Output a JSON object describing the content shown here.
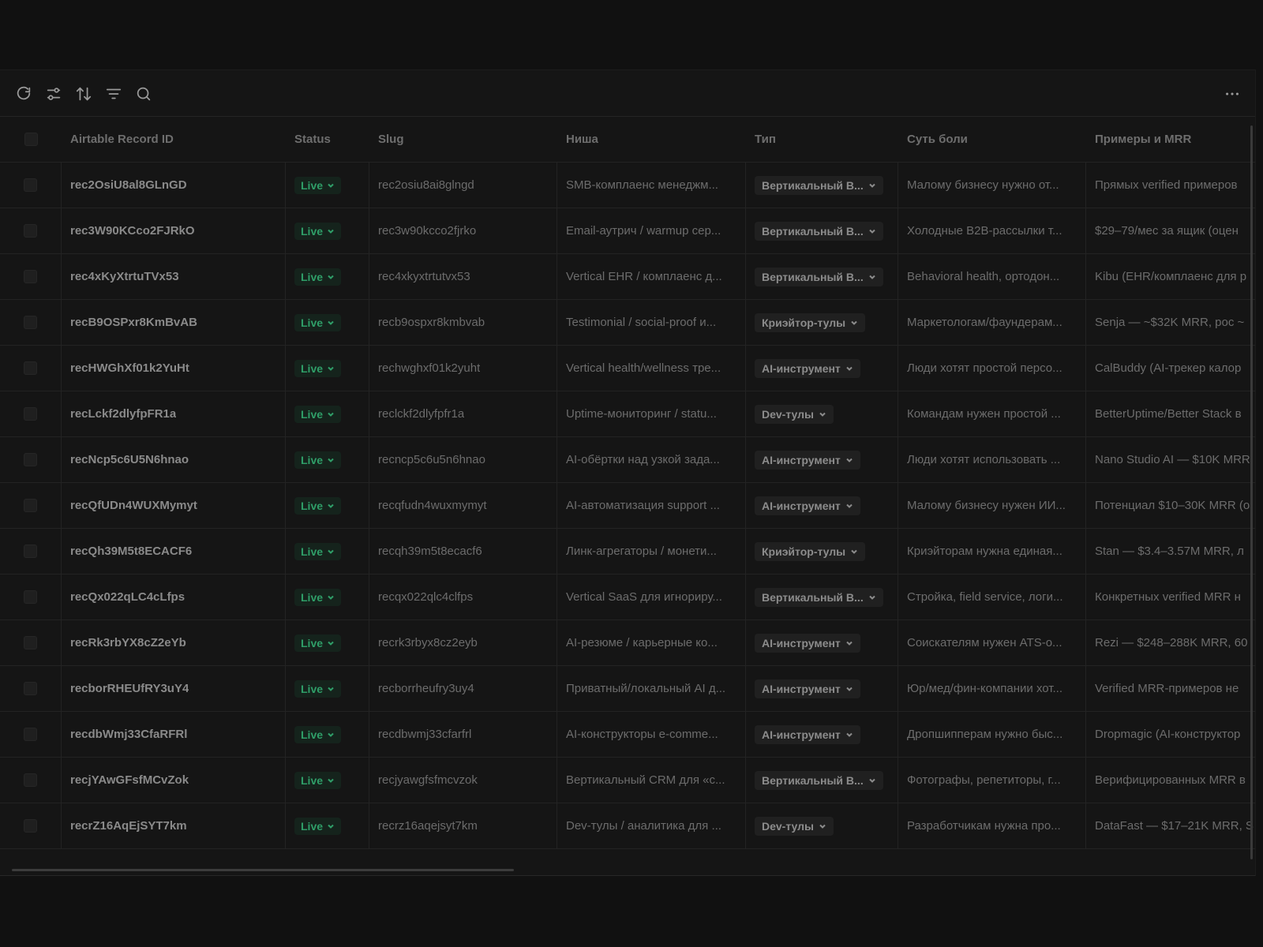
{
  "toolbar": {
    "icons": [
      "refresh-icon",
      "sliders-icon",
      "sort-icon",
      "filter-icon",
      "search-icon"
    ],
    "more_icon": "more-horizontal-icon"
  },
  "columns": {
    "id": "Airtable Record ID",
    "status": "Status",
    "slug": "Slug",
    "nisha": "Ниша",
    "tip": "Тип",
    "sut": "Суть боли",
    "mrr": "Примеры и MRR"
  },
  "colors": {
    "live_text": "#2f9e68",
    "live_bg": "#15231c",
    "background": "#111111"
  },
  "rows": [
    {
      "id": "rec2OsiU8al8GLnGD",
      "status": "Live",
      "slug": "rec2osiu8ai8glngd",
      "nisha": "SMB-комплаенс менеджм...",
      "tip": "Вертикальный В...",
      "sut": "Малому бизнесу нужно от...",
      "mrr": "Прямых verified примеров"
    },
    {
      "id": "rec3W90KCco2FJRkO",
      "status": "Live",
      "slug": "rec3w90kcco2fjrko",
      "nisha": "Email-аутрич / warmup сер...",
      "tip": "Вертикальный В...",
      "sut": "Холодные B2B-рассылки т...",
      "mrr": "$29–79/мес за ящик (оцен"
    },
    {
      "id": "rec4xKyXtrtuTVx53",
      "status": "Live",
      "slug": "rec4xkyxtrtutvx53",
      "nisha": "Vertical EHR / комплаенс д...",
      "tip": "Вертикальный В...",
      "sut": "Behavioral health, ортодон...",
      "mrr": "Kibu (EHR/комплаенс для р"
    },
    {
      "id": "recB9OSPxr8KmBvAB",
      "status": "Live",
      "slug": "recb9ospxr8kmbvab",
      "nisha": "Testimonial / social-proof и...",
      "tip": "Криэйтор-тулы",
      "sut": "Маркетологам/фаундерам...",
      "mrr": "Senja — ~$32K MRR, рос ~"
    },
    {
      "id": "recHWGhXf01k2YuHt",
      "status": "Live",
      "slug": "rechwghxf01k2yuht",
      "nisha": "Vertical health/wellness тре...",
      "tip": "AI-инструмент",
      "sut": "Люди хотят простой персо...",
      "mrr": "CalBuddy (AI-трекер калор"
    },
    {
      "id": "recLckf2dlyfpFR1a",
      "status": "Live",
      "slug": "reclckf2dlyfpfr1a",
      "nisha": "Uptime-мониторинг / statu...",
      "tip": "Dev-тулы",
      "sut": "Командам нужен простой ...",
      "mrr": "BetterUptime/Better Stack в"
    },
    {
      "id": "recNcp5c6U5N6hnao",
      "status": "Live",
      "slug": "recncp5c6u5n6hnao",
      "nisha": "AI-обёртки над узкой зада...",
      "tip": "AI-инструмент",
      "sut": "Люди хотят использовать ...",
      "mrr": "Nano Studio AI — $10K MRR"
    },
    {
      "id": "recQfUDn4WUXMymyt",
      "status": "Live",
      "slug": "recqfudn4wuxmymyt",
      "nisha": "AI-автоматизация support ...",
      "tip": "AI-инструмент",
      "sut": "Малому бизнесу нужен ИИ...",
      "mrr": "Потенциал $10–30K MRR (о"
    },
    {
      "id": "recQh39M5t8ECACF6",
      "status": "Live",
      "slug": "recqh39m5t8ecacf6",
      "nisha": "Линк-агрегаторы / монети...",
      "tip": "Криэйтор-тулы",
      "sut": "Криэйторам нужна единая...",
      "mrr": "Stan — $3.4–3.57M MRR, л"
    },
    {
      "id": "recQx022qLC4cLfps",
      "status": "Live",
      "slug": "recqx022qlc4clfps",
      "nisha": "Vertical SaaS для игнориру...",
      "tip": "Вертикальный В...",
      "sut": "Стройка, field service, логи...",
      "mrr": "Конкретных verified MRR н"
    },
    {
      "id": "recRk3rbYX8cZ2eYb",
      "status": "Live",
      "slug": "recrk3rbyx8cz2eyb",
      "nisha": "AI-резюме / карьерные ко...",
      "tip": "AI-инструмент",
      "sut": "Соискателям нужен ATS-о...",
      "mrr": "Rezi — $248–288K MRR, 60"
    },
    {
      "id": "recborRHEUfRY3uY4",
      "status": "Live",
      "slug": "recborrheufry3uy4",
      "nisha": "Приватный/локальный AI д...",
      "tip": "AI-инструмент",
      "sut": "Юр/мед/фин-компании хот...",
      "mrr": "Verified MRR-примеров не"
    },
    {
      "id": "recdbWmj33CfaRFRl",
      "status": "Live",
      "slug": "recdbwmj33cfarfrl",
      "nisha": "AI-конструкторы e-comme...",
      "tip": "AI-инструмент",
      "sut": "Дропшипперам нужно быс...",
      "mrr": "Dropmagic (AI-конструктор"
    },
    {
      "id": "recjYAwGFsfMCvZok",
      "status": "Live",
      "slug": "recjyawgfsfmcvzok",
      "nisha": "Вертикальный CRM для «с...",
      "tip": "Вертикальный В...",
      "sut": "Фотографы, репетиторы, г...",
      "mrr": "Верифицированных MRR в"
    },
    {
      "id": "recrZ16AqEjSYT7km",
      "status": "Live",
      "slug": "recrz16aqejsyt7km",
      "nisha": "Dev-тулы / аналитика для ...",
      "tip": "Dev-тулы",
      "sut": "Разработчикам нужна про...",
      "mrr": "DataFast — $17–21K MRR, S"
    }
  ]
}
